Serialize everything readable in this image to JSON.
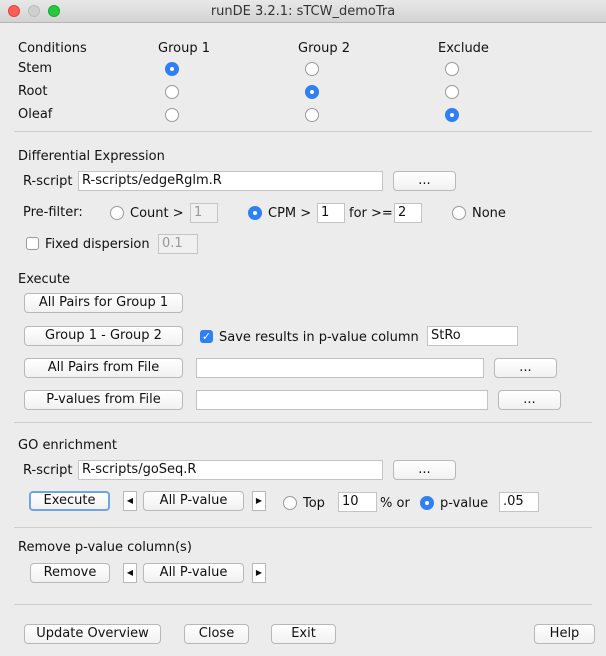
{
  "window": {
    "title": "runDE 3.2.1:   sTCW_demoTra"
  },
  "conditions": {
    "header": "Conditions",
    "columns": [
      "Group 1",
      "Group 2",
      "Exclude"
    ],
    "rows": [
      {
        "label": "Stem",
        "selected": 0
      },
      {
        "label": "Root",
        "selected": 1
      },
      {
        "label": "Oleaf",
        "selected": 2
      }
    ]
  },
  "de": {
    "header": "Differential Expression",
    "rscript_label": "R-script",
    "rscript_value": "R-scripts/edgeRglm.R",
    "browse_label": "...",
    "prefilter_label": "Pre-filter:",
    "count_label": "Count >",
    "count_value": "1",
    "cpm_label": "CPM >",
    "cpm_value": "1",
    "for_label": "for >=",
    "for_value": "2",
    "none_label": "None",
    "dispersion_label": "Fixed dispersion",
    "dispersion_value": "0.1"
  },
  "execute": {
    "header": "Execute",
    "all_pairs_group1": "All Pairs for Group 1",
    "group1_group2": "Group 1 - Group 2",
    "save_results_label": "Save results in p-value column",
    "save_results_value": "StRo",
    "all_pairs_file": "All Pairs from File",
    "pvalues_file": "P-values from File",
    "browse_label": "..."
  },
  "go": {
    "header": "GO enrichment",
    "rscript_label": "R-script",
    "rscript_value": "R-scripts/goSeq.R",
    "browse_label": "...",
    "execute_label": "Execute",
    "pvalue_select": "All P-value",
    "top_label": "Top",
    "top_value": "10",
    "percent_or": "% or",
    "pvalue_label": "p-value",
    "pvalue_value": ".05"
  },
  "remove": {
    "header": "Remove p-value column(s)",
    "remove_label": "Remove",
    "pvalue_select": "All P-value"
  },
  "footer": {
    "update_label": "Update Overview",
    "close_label": "Close",
    "exit_label": "Exit",
    "help_label": "Help"
  }
}
